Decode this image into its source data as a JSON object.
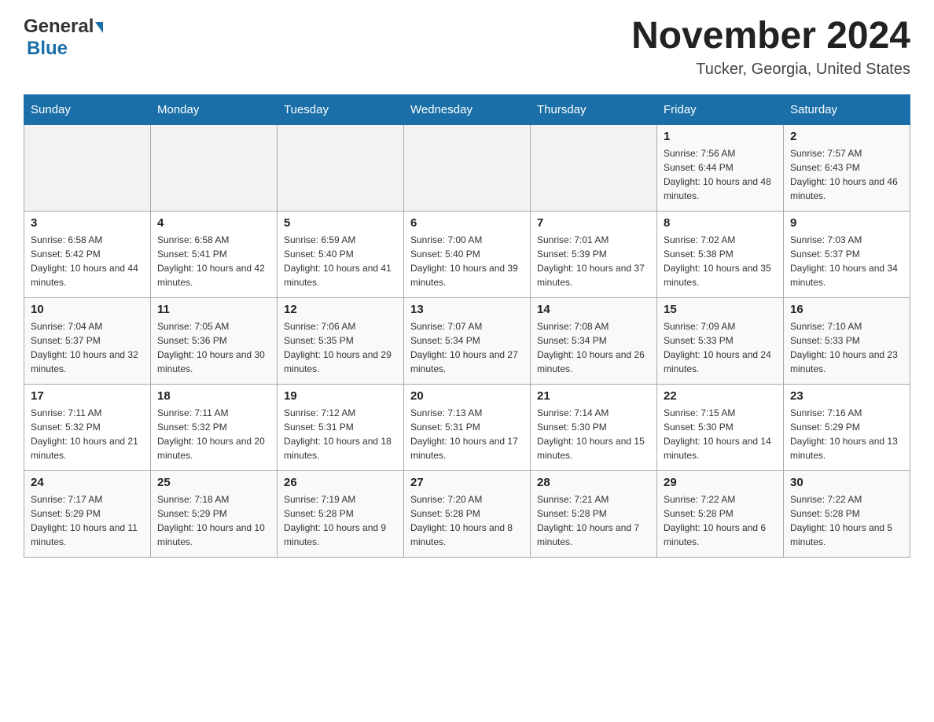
{
  "header": {
    "logo_general": "General",
    "logo_blue": "Blue",
    "month_title": "November 2024",
    "location": "Tucker, Georgia, United States"
  },
  "days_of_week": [
    "Sunday",
    "Monday",
    "Tuesday",
    "Wednesday",
    "Thursday",
    "Friday",
    "Saturday"
  ],
  "weeks": [
    {
      "days": [
        {
          "num": "",
          "info": ""
        },
        {
          "num": "",
          "info": ""
        },
        {
          "num": "",
          "info": ""
        },
        {
          "num": "",
          "info": ""
        },
        {
          "num": "",
          "info": ""
        },
        {
          "num": "1",
          "info": "Sunrise: 7:56 AM\nSunset: 6:44 PM\nDaylight: 10 hours and 48 minutes."
        },
        {
          "num": "2",
          "info": "Sunrise: 7:57 AM\nSunset: 6:43 PM\nDaylight: 10 hours and 46 minutes."
        }
      ]
    },
    {
      "days": [
        {
          "num": "3",
          "info": "Sunrise: 6:58 AM\nSunset: 5:42 PM\nDaylight: 10 hours and 44 minutes."
        },
        {
          "num": "4",
          "info": "Sunrise: 6:58 AM\nSunset: 5:41 PM\nDaylight: 10 hours and 42 minutes."
        },
        {
          "num": "5",
          "info": "Sunrise: 6:59 AM\nSunset: 5:40 PM\nDaylight: 10 hours and 41 minutes."
        },
        {
          "num": "6",
          "info": "Sunrise: 7:00 AM\nSunset: 5:40 PM\nDaylight: 10 hours and 39 minutes."
        },
        {
          "num": "7",
          "info": "Sunrise: 7:01 AM\nSunset: 5:39 PM\nDaylight: 10 hours and 37 minutes."
        },
        {
          "num": "8",
          "info": "Sunrise: 7:02 AM\nSunset: 5:38 PM\nDaylight: 10 hours and 35 minutes."
        },
        {
          "num": "9",
          "info": "Sunrise: 7:03 AM\nSunset: 5:37 PM\nDaylight: 10 hours and 34 minutes."
        }
      ]
    },
    {
      "days": [
        {
          "num": "10",
          "info": "Sunrise: 7:04 AM\nSunset: 5:37 PM\nDaylight: 10 hours and 32 minutes."
        },
        {
          "num": "11",
          "info": "Sunrise: 7:05 AM\nSunset: 5:36 PM\nDaylight: 10 hours and 30 minutes."
        },
        {
          "num": "12",
          "info": "Sunrise: 7:06 AM\nSunset: 5:35 PM\nDaylight: 10 hours and 29 minutes."
        },
        {
          "num": "13",
          "info": "Sunrise: 7:07 AM\nSunset: 5:34 PM\nDaylight: 10 hours and 27 minutes."
        },
        {
          "num": "14",
          "info": "Sunrise: 7:08 AM\nSunset: 5:34 PM\nDaylight: 10 hours and 26 minutes."
        },
        {
          "num": "15",
          "info": "Sunrise: 7:09 AM\nSunset: 5:33 PM\nDaylight: 10 hours and 24 minutes."
        },
        {
          "num": "16",
          "info": "Sunrise: 7:10 AM\nSunset: 5:33 PM\nDaylight: 10 hours and 23 minutes."
        }
      ]
    },
    {
      "days": [
        {
          "num": "17",
          "info": "Sunrise: 7:11 AM\nSunset: 5:32 PM\nDaylight: 10 hours and 21 minutes."
        },
        {
          "num": "18",
          "info": "Sunrise: 7:11 AM\nSunset: 5:32 PM\nDaylight: 10 hours and 20 minutes."
        },
        {
          "num": "19",
          "info": "Sunrise: 7:12 AM\nSunset: 5:31 PM\nDaylight: 10 hours and 18 minutes."
        },
        {
          "num": "20",
          "info": "Sunrise: 7:13 AM\nSunset: 5:31 PM\nDaylight: 10 hours and 17 minutes."
        },
        {
          "num": "21",
          "info": "Sunrise: 7:14 AM\nSunset: 5:30 PM\nDaylight: 10 hours and 15 minutes."
        },
        {
          "num": "22",
          "info": "Sunrise: 7:15 AM\nSunset: 5:30 PM\nDaylight: 10 hours and 14 minutes."
        },
        {
          "num": "23",
          "info": "Sunrise: 7:16 AM\nSunset: 5:29 PM\nDaylight: 10 hours and 13 minutes."
        }
      ]
    },
    {
      "days": [
        {
          "num": "24",
          "info": "Sunrise: 7:17 AM\nSunset: 5:29 PM\nDaylight: 10 hours and 11 minutes."
        },
        {
          "num": "25",
          "info": "Sunrise: 7:18 AM\nSunset: 5:29 PM\nDaylight: 10 hours and 10 minutes."
        },
        {
          "num": "26",
          "info": "Sunrise: 7:19 AM\nSunset: 5:28 PM\nDaylight: 10 hours and 9 minutes."
        },
        {
          "num": "27",
          "info": "Sunrise: 7:20 AM\nSunset: 5:28 PM\nDaylight: 10 hours and 8 minutes."
        },
        {
          "num": "28",
          "info": "Sunrise: 7:21 AM\nSunset: 5:28 PM\nDaylight: 10 hours and 7 minutes."
        },
        {
          "num": "29",
          "info": "Sunrise: 7:22 AM\nSunset: 5:28 PM\nDaylight: 10 hours and 6 minutes."
        },
        {
          "num": "30",
          "info": "Sunrise: 7:22 AM\nSunset: 5:28 PM\nDaylight: 10 hours and 5 minutes."
        }
      ]
    }
  ]
}
